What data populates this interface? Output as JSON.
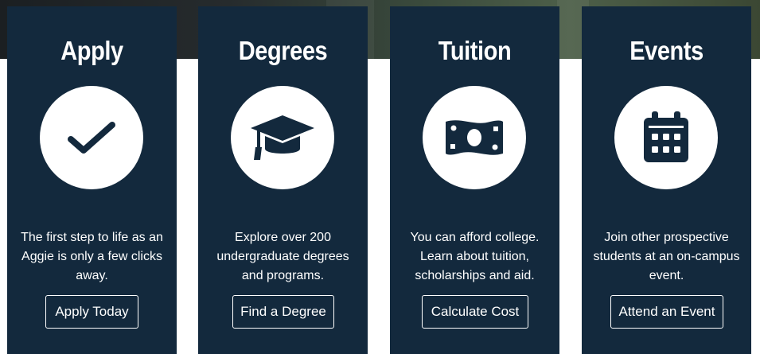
{
  "colors": {
    "card_background": "#13293d",
    "icon_circle": "#ffffff",
    "icon_fill": "#13293d",
    "text": "#ffffff"
  },
  "cards": [
    {
      "title": "Apply",
      "icon": "check-icon",
      "description": "The first step to life as an Aggie is only a few clicks away.",
      "button_label": "Apply Today"
    },
    {
      "title": "Degrees",
      "icon": "graduation-cap-icon",
      "description": "Explore over 200 undergraduate degrees and programs.",
      "button_label": "Find a Degree"
    },
    {
      "title": "Tuition",
      "icon": "money-bill-icon",
      "description": "You can afford college. Learn about tuition, scholarships and aid.",
      "button_label": "Calculate Cost"
    },
    {
      "title": "Events",
      "icon": "calendar-icon",
      "description": "Join other prospective students at an on-campus event.",
      "button_label": "Attend an Event"
    }
  ]
}
